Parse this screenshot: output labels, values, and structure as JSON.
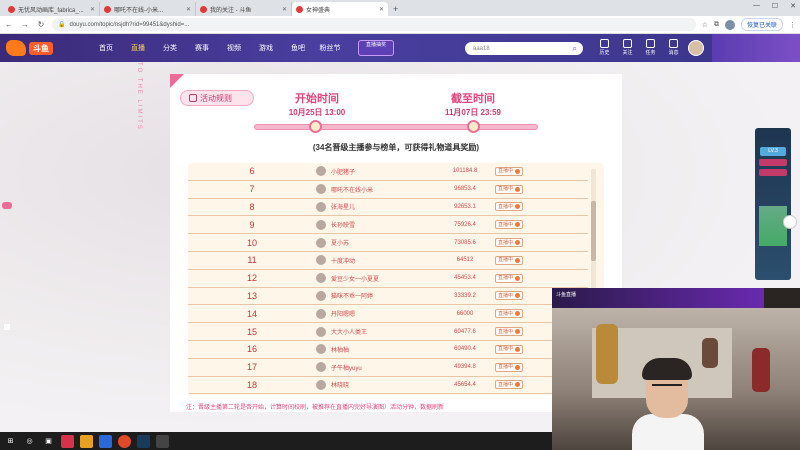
{
  "browser": {
    "tabs": [
      {
        "title": "无忧风动画库_fabrica_..."
      },
      {
        "title": "哪吒不在线-小米..."
      },
      {
        "title": "我的关注 - 斗鱼"
      },
      {
        "title": "女神盛典"
      }
    ],
    "url": "douyu.com/topic/nsjdh?rid=99451&dyshid=...",
    "resume_label": "恢复已关联"
  },
  "site": {
    "brand": "斗鱼",
    "nav": [
      "首页",
      "直播",
      "分类",
      "赛事",
      "视频",
      "游戏",
      "鱼吧",
      "粉丝节"
    ],
    "promo": "直播抽奖",
    "search_placeholder": "aaa18",
    "header_icons": [
      "历史",
      "关注",
      "任务",
      "消息",
      "开播中心"
    ]
  },
  "event": {
    "rules_label": "活动规则",
    "start_title": "开始时间",
    "start_time": "10月25日 13:00",
    "end_title": "截至时间",
    "end_time": "11月07日 23:59",
    "subtitle": "(34名晋级主播参与榜单，可获得礼物道具奖励)",
    "status_label": "直播中",
    "note": "注：晋级主播第二轮是否开始，计算时间校刷，被推荐在直播内完好导演图）活动分钟，数据刷新",
    "vertical_tag": "TO THE LIMITS"
  },
  "ranking": [
    {
      "rank": "6",
      "name": "小肥猪子",
      "score": "101184.8"
    },
    {
      "rank": "7",
      "name": "哪吒不在线小米",
      "score": "96853.4"
    },
    {
      "rank": "8",
      "name": "张海星儿",
      "score": "92653.1"
    },
    {
      "rank": "9",
      "name": "长孙映雪",
      "score": "75926.4"
    },
    {
      "rank": "10",
      "name": "夏小苏",
      "score": "73085.6"
    },
    {
      "rank": "11",
      "name": "十度冲动",
      "score": "64512"
    },
    {
      "rank": "12",
      "name": "爱豆少女一小夏夏",
      "score": "45453.4"
    },
    {
      "rank": "13",
      "name": "猫咪不乖一阿婷",
      "score": "33339.2"
    },
    {
      "rank": "14",
      "name": "丹阳嗯嗯",
      "score": "66000"
    },
    {
      "rank": "15",
      "name": "大大小人类王",
      "score": "60477.6"
    },
    {
      "rank": "16",
      "name": "林柚柚",
      "score": "60490.4"
    },
    {
      "rank": "17",
      "name": "子午柚yuyu",
      "score": "49394.8"
    },
    {
      "rank": "18",
      "name": "林晓晓",
      "score": "45654.4"
    }
  ],
  "side_panel": {
    "level": "LV.3"
  },
  "cam": {
    "bar_text": "斗鱼直播"
  }
}
